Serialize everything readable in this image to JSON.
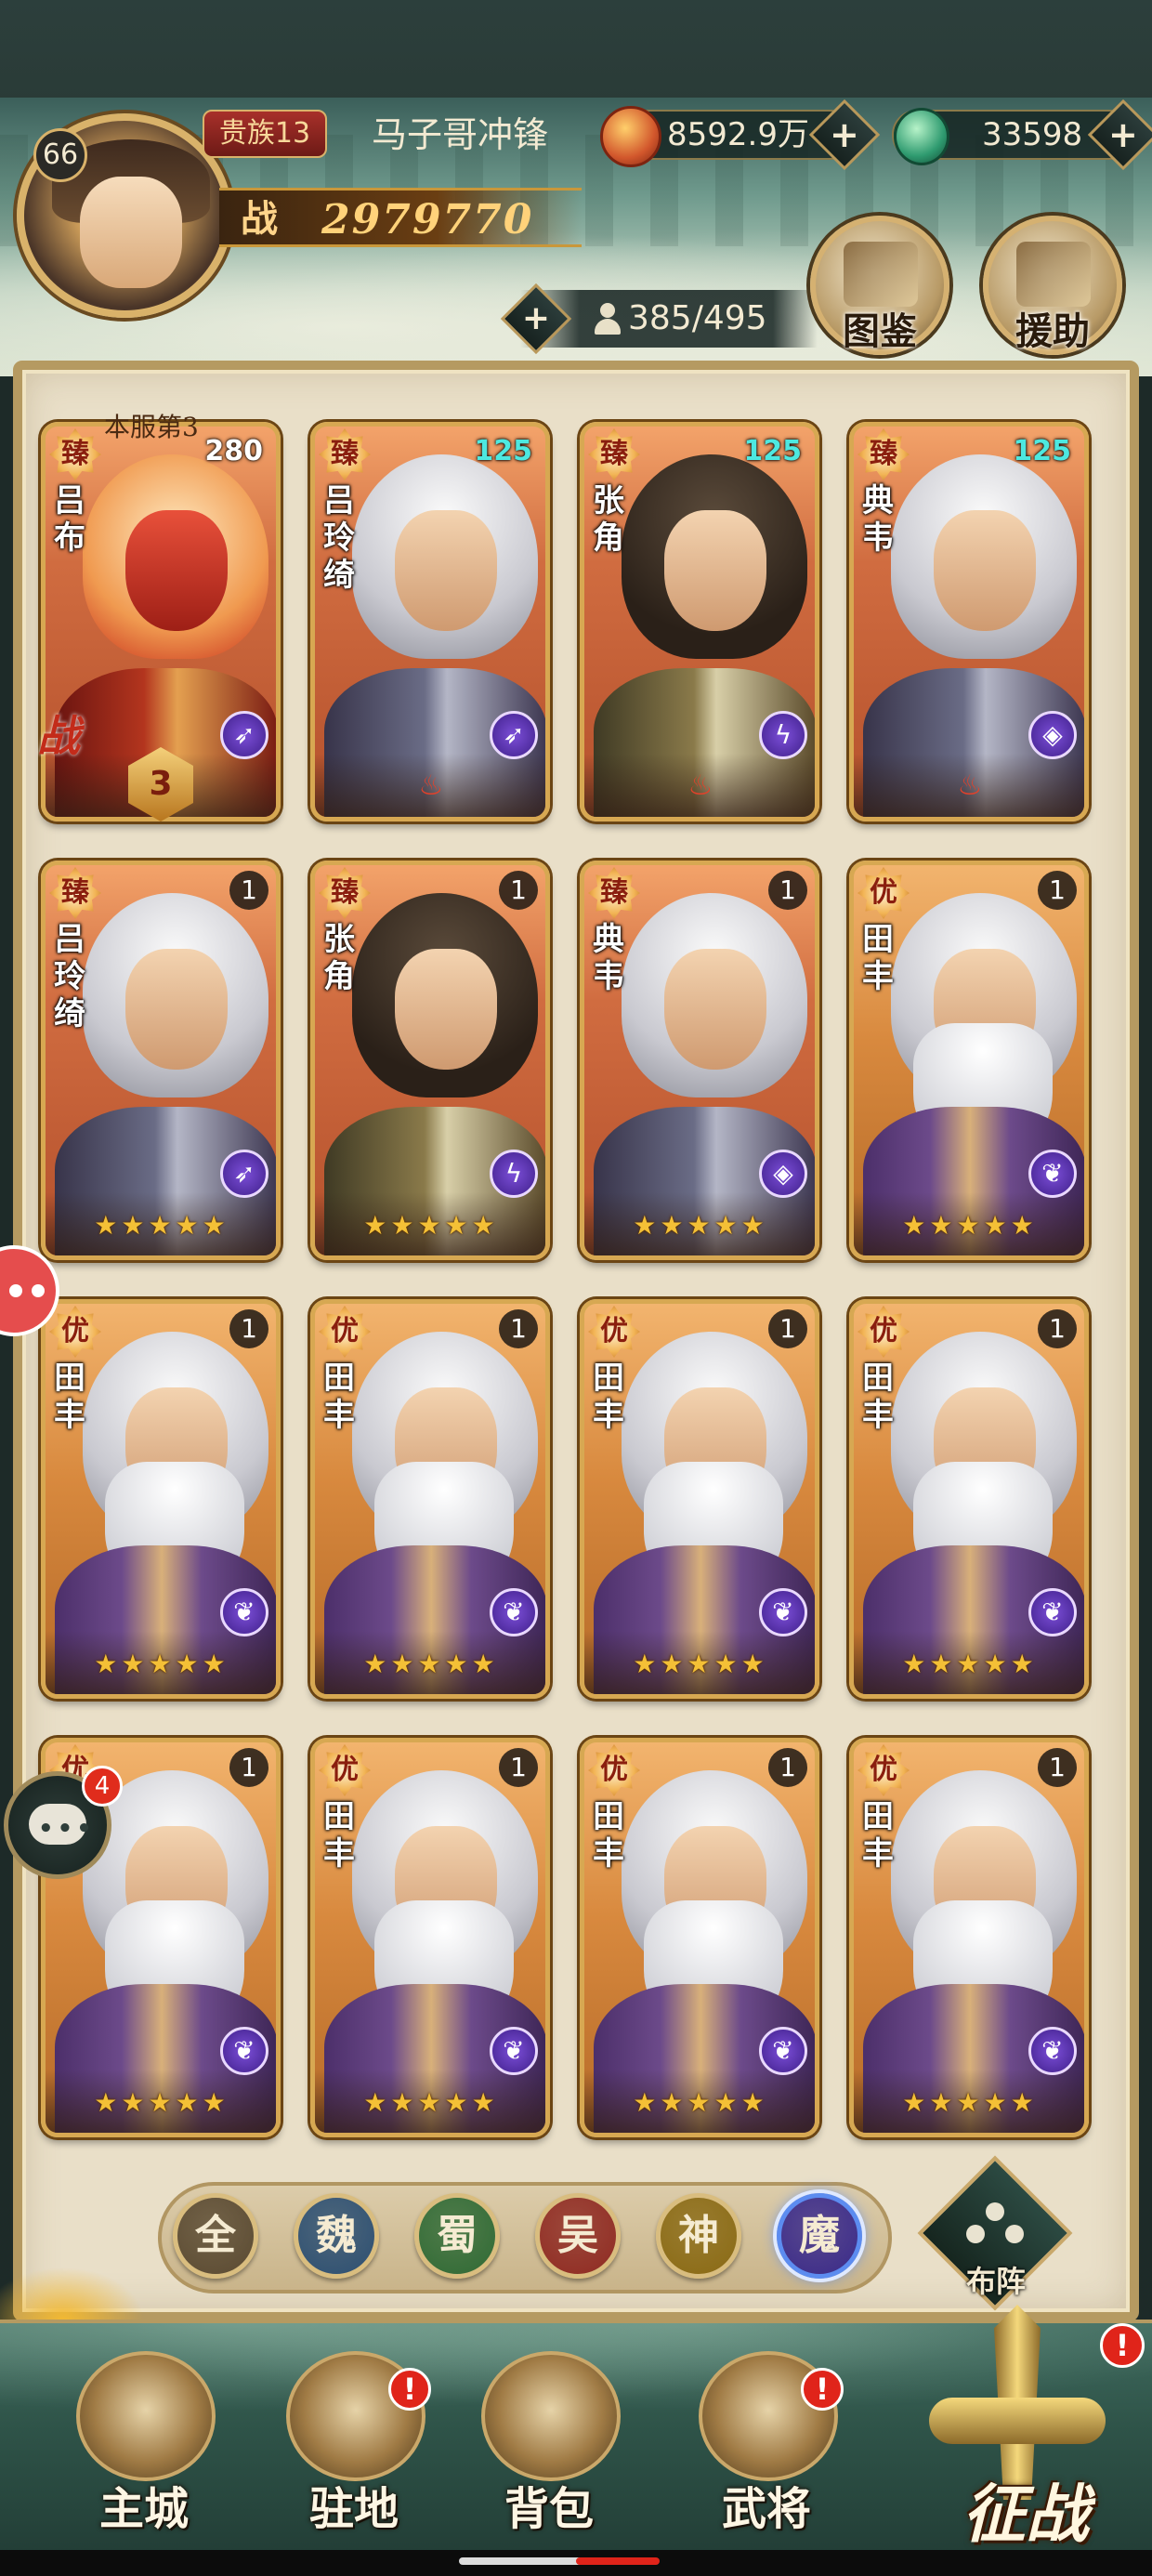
{
  "player": {
    "level": "66",
    "noble_rank": "贵族13",
    "name": "马子哥冲锋",
    "power_icon": "战",
    "power": "2979770",
    "gold": "8592.9万",
    "jade": "33598",
    "hero_capacity": "385/495"
  },
  "header_buttons": {
    "codex": "图鉴",
    "assist": "援助",
    "add": "+"
  },
  "roster": {
    "server_rank": "本服第3",
    "war_stamp": "战",
    "awaken_level": "3",
    "stars": "★★★★★",
    "heroes": [
      {
        "rank": "臻",
        "name": "吕布",
        "level": "280",
        "class": "bow-icon",
        "style": "big"
      },
      {
        "rank": "臻",
        "name": "吕玲绮",
        "level": "125",
        "class": "bow-icon",
        "style": "cyan"
      },
      {
        "rank": "臻",
        "name": "张角",
        "level": "125",
        "class": "staff-icon",
        "style": "cyan"
      },
      {
        "rank": "臻",
        "name": "典韦",
        "level": "125",
        "class": "shield-icon",
        "style": "cyan"
      },
      {
        "rank": "臻",
        "name": "吕玲绮",
        "level": "1",
        "class": "bow-icon",
        "style": "plain"
      },
      {
        "rank": "臻",
        "name": "张角",
        "level": "1",
        "class": "staff-icon",
        "style": "plain"
      },
      {
        "rank": "臻",
        "name": "典韦",
        "level": "1",
        "class": "shield-icon",
        "style": "plain"
      },
      {
        "rank": "优",
        "name": "田丰",
        "level": "1",
        "class": "leaf-icon",
        "style": "plain"
      },
      {
        "rank": "优",
        "name": "田丰",
        "level": "1",
        "class": "leaf-icon",
        "style": "plain"
      },
      {
        "rank": "优",
        "name": "田丰",
        "level": "1",
        "class": "leaf-icon",
        "style": "plain"
      },
      {
        "rank": "优",
        "name": "田丰",
        "level": "1",
        "class": "leaf-icon",
        "style": "plain"
      },
      {
        "rank": "优",
        "name": "田丰",
        "level": "1",
        "class": "leaf-icon",
        "style": "plain"
      },
      {
        "rank": "优",
        "name": "田丰",
        "level": "1",
        "class": "leaf-icon",
        "style": "plain"
      },
      {
        "rank": "优",
        "name": "田丰",
        "level": "1",
        "class": "leaf-icon",
        "style": "plain"
      },
      {
        "rank": "优",
        "name": "田丰",
        "level": "1",
        "class": "leaf-icon",
        "style": "plain"
      },
      {
        "rank": "优",
        "name": "田丰",
        "level": "1",
        "class": "leaf-icon",
        "style": "plain"
      }
    ]
  },
  "factions": [
    {
      "label": "全",
      "color": "#5a4a32",
      "active": false
    },
    {
      "label": "魏",
      "color": "#2c4f72",
      "active": false
    },
    {
      "label": "蜀",
      "color": "#2f6a35",
      "active": false
    },
    {
      "label": "吴",
      "color": "#8f2a22",
      "active": false
    },
    {
      "label": "神",
      "color": "#8a6a14",
      "active": false
    },
    {
      "label": "魔",
      "color": "#3a2a8a",
      "active": true
    }
  ],
  "formation_label": "布阵",
  "chat_badge": "4",
  "bottom_nav": {
    "main_city": "主城",
    "garrison": "驻地",
    "backpack": "背包",
    "generals": "武将",
    "expedition": "征战",
    "alert": "!"
  }
}
